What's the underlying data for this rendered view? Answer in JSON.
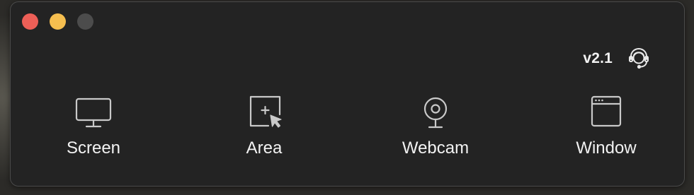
{
  "window": {
    "traffic_lights": {
      "close_color": "#ed5f57",
      "minimize_color": "#f5be4f",
      "zoom_color": "#4c4c4c"
    }
  },
  "header": {
    "version": "v2.1",
    "support_icon": "headset-support-icon"
  },
  "modes": [
    {
      "label": "Screen",
      "icon": "monitor-icon"
    },
    {
      "label": "Area",
      "icon": "area-select-icon"
    },
    {
      "label": "Webcam",
      "icon": "webcam-icon"
    },
    {
      "label": "Window",
      "icon": "app-window-icon"
    }
  ]
}
